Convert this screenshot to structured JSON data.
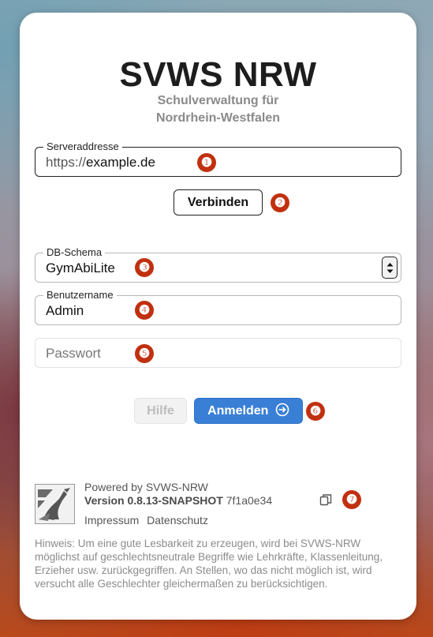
{
  "app": {
    "title": "SVWS NRW",
    "subtitle_line1": "Schulverwaltung für",
    "subtitle_line2": "Nordrhein-Westfalen"
  },
  "server": {
    "legend": "Serveraddresse",
    "prefix": "https://",
    "value": "example.de",
    "connect_label": "Verbinden"
  },
  "schema": {
    "legend": "DB-Schema",
    "selected": "GymAbiLite"
  },
  "username": {
    "legend": "Benutzername",
    "value": "Admin"
  },
  "password": {
    "placeholder": "Passwort"
  },
  "actions": {
    "help_label": "Hilfe",
    "login_label": "Anmelden"
  },
  "footer": {
    "powered_by": "Powered by SVWS-NRW",
    "version_label": "Version 0.8.13-SNAPSHOT",
    "commit": "7f1a0e34",
    "impressum": "Impressum",
    "datenschutz": "Datenschutz",
    "note": "Hinweis: Um eine gute Lesbarkeit zu erzeugen, wird bei SVWS-NRW möglichst auf geschlechtsneutrale Begriffe wie Lehrkräfte, Klassenleitung, Erzieher usw. zurückgegriffen. An Stellen, wo das nicht möglich ist, wird versucht alle Geschlechter gleichermaßen zu berücksichtigen."
  },
  "annotations": [
    "❶",
    "❷",
    "❸",
    "❹",
    "❺",
    "❻",
    "❼"
  ],
  "colors": {
    "accent": "#3a7fd6",
    "annotation": "#c1300f"
  }
}
